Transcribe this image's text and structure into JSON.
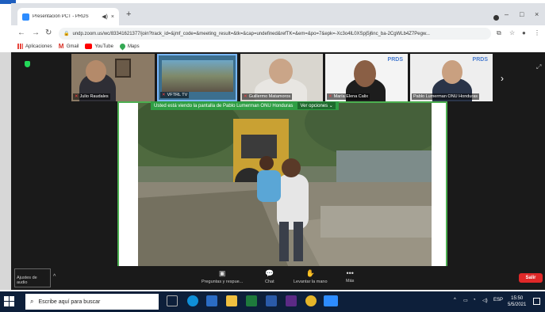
{
  "browser": {
    "tab_title": "Presentación PCT - PRDS",
    "tab_audio_icon": "speaker-icon",
    "tab_close": "×",
    "new_tab": "+",
    "url": "undp.zoom.us/wc/83341621377/join?track_id=&jmf_code=&meeting_result=&tk=&cap=undefined&refTK=&em=&po=7&epk=-Xc3o4lL0XSpj5j6nc_ba-2CgWLb4Z7Pegw...",
    "window_controls": [
      "–",
      "□",
      "×"
    ],
    "bookmarks": [
      {
        "label": "Aplicaciones",
        "icon": "apps-grid-icon",
        "color": "#e8453c"
      },
      {
        "label": "Gmail",
        "icon": "gmail-icon",
        "color": "#d93025"
      },
      {
        "label": "YouTube",
        "icon": "youtube-icon",
        "color": "#ff0000"
      },
      {
        "label": "Maps",
        "icon": "maps-pin-icon",
        "color": "#34a853"
      }
    ]
  },
  "zoom": {
    "participants": [
      {
        "name": "Julio Raudales"
      },
      {
        "name": "VFTRL TV"
      },
      {
        "name": "Guillermo Matamoros"
      },
      {
        "name": "María Elena Calix"
      },
      {
        "name": "Pablo Lumerman ONU Honduras"
      }
    ],
    "logo_text": "PRDS",
    "share_banner": "Usted está viendo la pantalla de Pablo Lumerman ONU Honduras",
    "view_options": "Ver opciones ⌄",
    "toolbar": {
      "audio_settings": "Ajustes de audio",
      "qa": "Preguntas y respue...",
      "chat": "Chat",
      "raise_hand": "Levantar la mano",
      "more": "Más",
      "leave": "Salir"
    }
  },
  "taskbar": {
    "search_placeholder": "Escribe aquí para buscar",
    "language": "ESP",
    "time": "15:50",
    "date": "5/5/2021"
  }
}
